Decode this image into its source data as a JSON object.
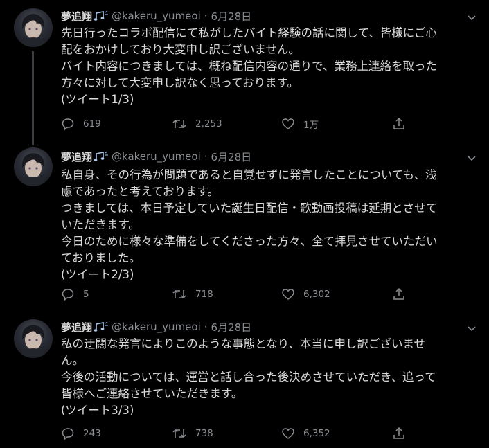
{
  "tweets": [
    {
      "name": "夢追翔",
      "handle": "@kakeru_yumeoi",
      "date": "6月28日",
      "lines": [
        "先日行ったコラボ配信にて私がしたバイト経験の話に関して、皆様にご心",
        "配をおかけしており大変申し訳ございません。",
        "バイト内容につきましては、概ね配信内容の通りで、業務上連絡を取った",
        "方々に対して大変申し訳なく思っております。",
        "(ツイート1/3)"
      ],
      "replies": "619",
      "retweets": "2,253",
      "likes": "1万"
    },
    {
      "name": "夢追翔",
      "handle": "@kakeru_yumeoi",
      "date": "6月28日",
      "lines": [
        "私自身、その行為が問題であると自覚せずに発言したことについても、浅",
        "慮であったと考えております。",
        "つきましては、本日予定していた誕生日配信・歌動画投稿は延期とさせて",
        "いただきます。",
        "今日のために様々な準備をしてくださった方々、全て拝見させていただい",
        "ておりました。",
        "(ツイート2/3)"
      ],
      "replies": "5",
      "retweets": "718",
      "likes": "6,302"
    },
    {
      "name": "夢追翔",
      "handle": "@kakeru_yumeoi",
      "date": "6月28日",
      "lines": [
        "私の迂闊な発言によりこのような事態となり、本当に申し訳ございませ",
        "ん。",
        "今後の活動については、運営と話し合った後決めさせていただき、追って",
        "皆様へご連絡させていただきます。",
        "(ツイート3/3)"
      ],
      "replies": "243",
      "retweets": "738",
      "likes": "6,352"
    }
  ],
  "icons": {
    "badge": "music-note-emoji-icon",
    "caret": "chevron-down-icon",
    "reply": "reply-bubble-icon",
    "retweet": "retweet-icon",
    "like": "heart-icon",
    "share": "share-icon"
  },
  "colors": {
    "background": "#000000",
    "text": "#d9d9d9",
    "muted": "#8b8f94",
    "thread_line": "#3a3d42"
  }
}
